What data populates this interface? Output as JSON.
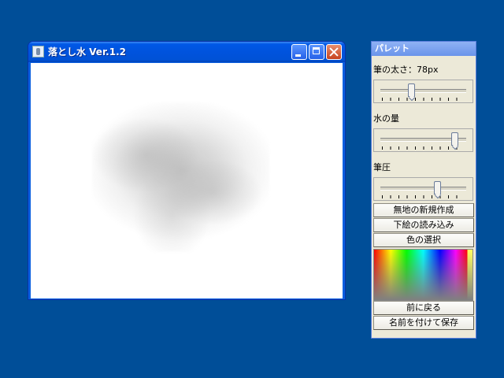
{
  "main_window": {
    "title": "落とし水 Ver.1.2",
    "icon": "app-icon",
    "buttons": {
      "minimize": "minimize-icon",
      "maximize": "maximize-icon",
      "close": "close-icon"
    }
  },
  "palette": {
    "title": "パレット",
    "brush_size": {
      "label": "筆の太さ：",
      "value": "78px",
      "level": 0.35
    },
    "water_amount": {
      "label": "水の量",
      "level": 0.9
    },
    "pressure": {
      "label": "筆圧",
      "level": 0.68
    },
    "buttons": {
      "new_blank": "無地の新規作成",
      "load_sketch": "下絵の読み込み",
      "select_color": "色の選択",
      "undo": "前に戻る",
      "save_as": "名前を付けて保存"
    }
  },
  "colors": {
    "desktop": "#004e98",
    "titlebar": "#0054e3",
    "palette_bg": "#ece9d8"
  }
}
